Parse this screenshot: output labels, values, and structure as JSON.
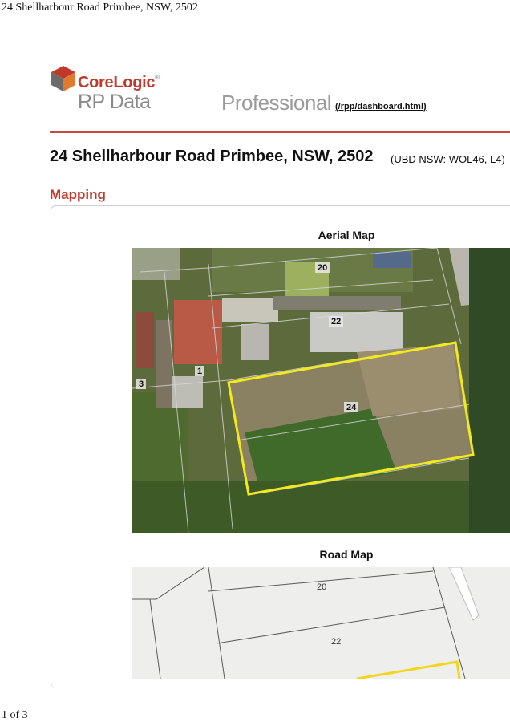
{
  "print": {
    "header_title": "24 Shellharbour Road Primbee, NSW, 2502",
    "page_indicator": "1 of 3"
  },
  "brand": {
    "corelogic": "CoreLogic",
    "registered_mark": "®",
    "rp_data": "RP Data",
    "professional": "Professional",
    "dashboard_link": "(/rpp/dashboard.html)",
    "accent_color": "#c0392b",
    "logo_colors": [
      "#c0392b",
      "#e07a2e",
      "#6b6b6b"
    ]
  },
  "property": {
    "address": "24 Shellharbour Road Primbee, NSW, 2502",
    "ubd_reference": "(UBD NSW: WOL46, L4)"
  },
  "mapping": {
    "heading": "Mapping",
    "aerial": {
      "caption": "Aerial Map",
      "lot_labels": [
        "20",
        "22",
        "24",
        "1",
        "3"
      ],
      "boundary_color": "#f2ea1c"
    },
    "road": {
      "caption": "Road Map",
      "lot_labels": [
        "20",
        "22"
      ],
      "boundary_color": "#f2d61c"
    }
  }
}
